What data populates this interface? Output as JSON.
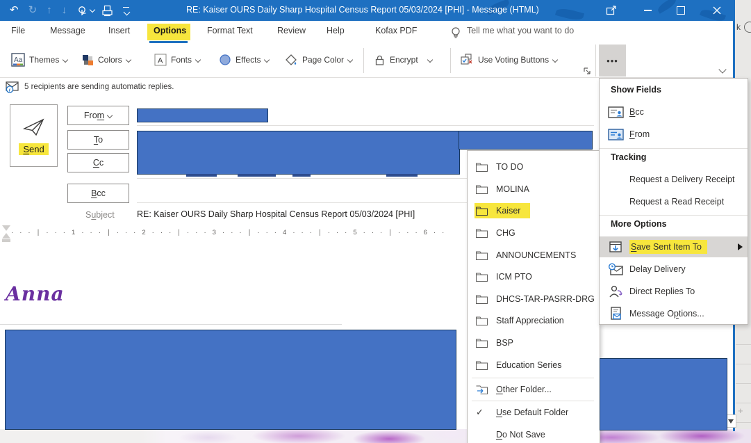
{
  "window": {
    "title": "RE:  Kaiser OURS Daily Sharp Hospital Census Report 05/03/2024  [PHI]  -  Message (HTML)",
    "edge_text": "k",
    "edge_plus": "+"
  },
  "tabs": {
    "file": "File",
    "message": "Message",
    "insert": "Insert",
    "options": "Options",
    "format_text": "Format Text",
    "review": "Review",
    "help": "Help",
    "kofax": "Kofax PDF",
    "tell_me": "Tell me what you want to do"
  },
  "ribbon": {
    "themes": "Themes",
    "colors": "Colors",
    "fonts": "Fonts",
    "effects": "Effects",
    "page_color": "Page Color",
    "encrypt": "Encrypt",
    "voting": "Use Voting Buttons",
    "overflow": "•••"
  },
  "infobar": "5 recipients are sending automatic replies.",
  "compose": {
    "send": {
      "pre": "",
      "key": "S",
      "post": "end"
    },
    "from_btn": {
      "pre": "Fro",
      "key": "m",
      "post": ""
    },
    "to_btn": {
      "pre": "",
      "key": "T",
      "post": "o"
    },
    "cc_btn": {
      "pre": "",
      "key": "C",
      "post": "c"
    },
    "bcc_btn": {
      "pre": "",
      "key": "B",
      "post": "cc"
    },
    "subject_label": {
      "pre": "S",
      "key": "u",
      "post": "bject"
    },
    "subject": "RE:  Kaiser OURS Daily Sharp Hospital Census Report 05/03/2024  [PHI]"
  },
  "ruler": {
    "text": "· · ·  ∣  · · ·  1  · · ·  ∣  · · ·  2  · · ·  ∣  · · ·  3  · · ·  ∣  · · ·  4  · · ·  ∣  · · ·  5  · · ·  ∣  · · ·  6  · ·"
  },
  "signature": "Anna",
  "folder_menu": {
    "items": [
      "TO DO",
      "MOLINA",
      "Kaiser",
      "CHG",
      "ANNOUNCEMENTS",
      "ICM PTO",
      "DHCS-TAR-PASRR-DRG",
      "Staff Appreciation",
      "BSP",
      "Education Series"
    ],
    "highlighted_item": "Kaiser",
    "other": {
      "pre": "",
      "key": "O",
      "post": "ther Folder..."
    },
    "use_default": {
      "pre": "",
      "key": "U",
      "post": "se Default Folder"
    },
    "do_not_save": {
      "pre": "",
      "key": "D",
      "post": "o Not Save"
    }
  },
  "options_menu": {
    "show_fields": "Show Fields",
    "bcc": {
      "pre": "",
      "key": "B",
      "post": "cc"
    },
    "from": {
      "pre": "",
      "key": "F",
      "post": "rom"
    },
    "tracking": "Tracking",
    "delivery_receipt": "Request a Delivery Receipt",
    "read_receipt": "Request a Read Receipt",
    "more_options": "More Options",
    "save_sent": {
      "pre": "",
      "key": "S",
      "post": "ave Sent Item To"
    },
    "delay": "Delay Delivery",
    "direct_replies": "Direct Replies To",
    "msg_options": {
      "pre": "Message O",
      "key": "p",
      "post": "tions..."
    }
  },
  "colors": {
    "titlebar": "#1e70c1",
    "highlight_yellow": "#f7e63d",
    "redaction_blue": "#4472c4",
    "tab_underline": "#1e70c1"
  }
}
